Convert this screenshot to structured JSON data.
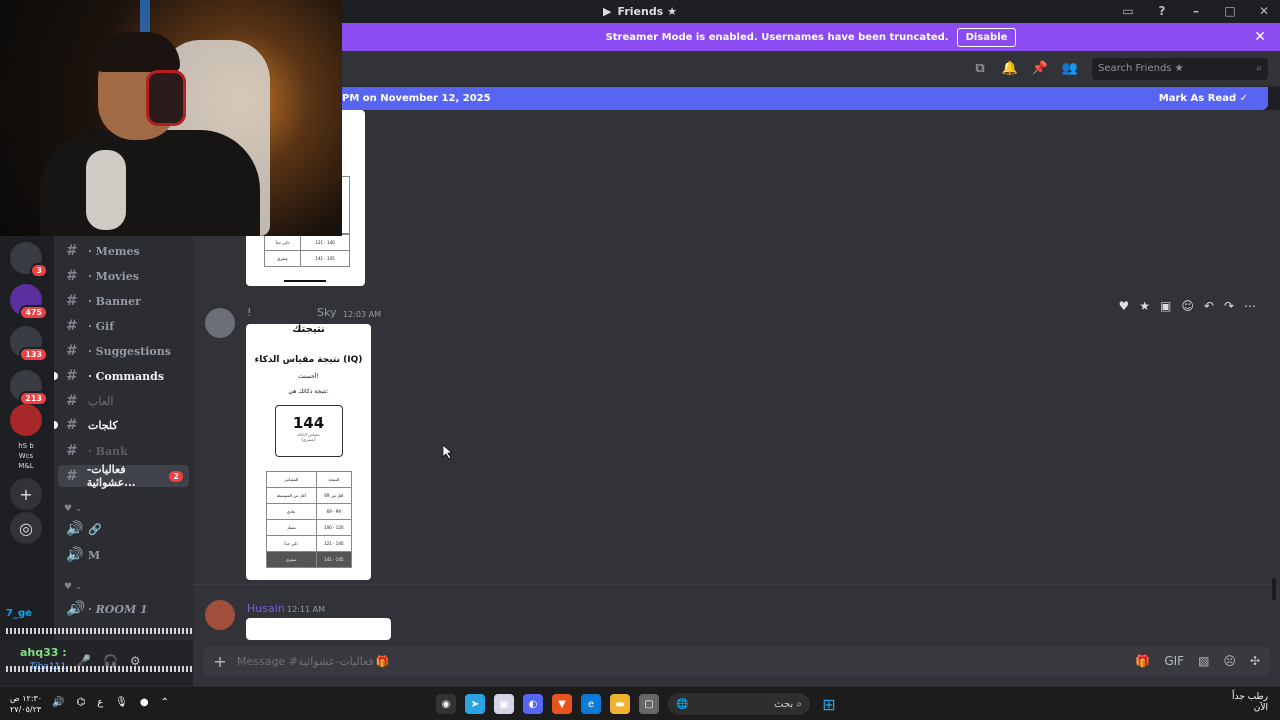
{
  "window": {
    "title": "Friends ★"
  },
  "streamer_banner": {
    "text": "Streamer Mode is enabled. Usernames have been truncated.",
    "button": "Disable"
  },
  "header": {
    "search_placeholder": "Search Friends ★"
  },
  "unread_bar": {
    "text": "PM on November 12, 2025",
    "mark_read": "Mark As Read"
  },
  "servers": [
    {
      "badge": "3"
    },
    {
      "badge": "475"
    },
    {
      "badge": "133"
    },
    {
      "badge": "213"
    },
    {
      "badge": ""
    },
    {
      "label": "hS b Wcs M&L"
    }
  ],
  "channels": [
    {
      "name": "· Memes"
    },
    {
      "name": "· Movies"
    },
    {
      "name": "· Banner"
    },
    {
      "name": "· Gif"
    },
    {
      "name": "· Suggestions"
    },
    {
      "name": "· Commands"
    },
    {
      "name": "العاب"
    },
    {
      "name": "كلجات"
    },
    {
      "name": "· Bank"
    },
    {
      "name": "فعاليات-عشوائية...",
      "badge": "2"
    },
    {
      "name": "M"
    },
    {
      "name": "· ROOM 1"
    }
  ],
  "chat_overlay": {
    "user1": "7_ge",
    "user2": "ahq33 :",
    "user3": "Tiba111"
  },
  "messages": [
    {
      "author": "Sky",
      "time": "12:03 AM",
      "card": {
        "heading": "نتيجتك",
        "title": "نتيجة مقياس الذكاء (IQ)",
        "congrats": "أحسنت!",
        "result_label": "نتيجة ذكائك هي:",
        "score": "144",
        "score_label": "مقياس الذكاء",
        "score_class": "(عبقري)",
        "table_header": [
          "النتيجة",
          "المقياس"
        ],
        "rows": [
          [
            "أقل من 69",
            "أقل من المتوسط"
          ],
          [
            "69 - 99",
            "عادي"
          ],
          [
            "100 - 120",
            "ممتاز"
          ],
          [
            "121 - 140",
            "ذكي جداً"
          ],
          [
            "141 - 145",
            "عبقري"
          ]
        ]
      }
    },
    {
      "author": "Husain",
      "time": "12:11 AM"
    }
  ],
  "earlier_card": {
    "rows": [
      [
        "121 - 140",
        "ذكي جداً"
      ],
      [
        "141 - 145",
        "عبقري"
      ]
    ]
  },
  "composer": {
    "placeholder": "Message #فعاليات-عشوائية"
  },
  "taskbar": {
    "time": "١٢:٣٠ ص",
    "date": "٢٧/٠٥/٢٣",
    "lang": "ع",
    "search": "بحث",
    "weather": "رطب جداً",
    "weather_sub": "الآن"
  }
}
